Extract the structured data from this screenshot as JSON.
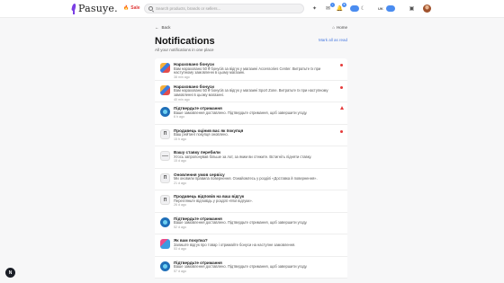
{
  "header": {
    "brand": "Pasuye.",
    "sale_label": "Sale",
    "search_placeholder": "Search products, brands or sellers...",
    "notifications_count": "5",
    "pill_1": "",
    "language": "UK",
    "pill_2": "",
    "icons": [
      "sparkles-icon",
      "bell-icon",
      "moon-icon",
      "orders-icon",
      "avatar"
    ]
  },
  "page": {
    "back_label": "Back",
    "home_label": "Home",
    "title": "Notifications",
    "subtitle": "All your notifications in one place",
    "mark_all_label": "Mark all as read"
  },
  "notifications": [
    {
      "icon": "gift",
      "title": "Нараховано бонуси",
      "text": "Вам нараховано 50 ₴ бонусів за відгук у магазині Accessories Center. Витратьте їх при наступному замовленні в цьому магазині.",
      "time": "38 min ago",
      "indicator": "dot"
    },
    {
      "icon": "gift",
      "title": "Нараховано бонуси",
      "text": "Вам нараховано 50 ₴ бонусів за відгук у магазині Sport Zone. Витратьте їх при наступному замовленні в цьому магазині.",
      "time": "40 min ago",
      "indicator": "dot"
    },
    {
      "icon": "ok",
      "title": "Підтвердьте отримання",
      "text": "Ваше замовлення доставлено. Підтвердьте отримання, щоб завершити угоду.",
      "time": "6 h ago",
      "indicator": "tri"
    },
    {
      "icon": "p",
      "title": "Продавець оцінив вас як покупця",
      "text": "Ваш рейтинг покупця оновлено.",
      "time": "15 h ago",
      "indicator": "dot"
    },
    {
      "icon": "line",
      "title": "Вашу ставку перебили",
      "text": "Хтось запропонував більше за лот, за яким ви стежите. Встигніть підняти ставку.",
      "time": "15 d ago",
      "indicator": ""
    },
    {
      "icon": "p",
      "title": "Оновлення умов сервісу",
      "text": "Ми оновили правила повернення. Ознайомтесь у розділі «Доставка й повернення».",
      "time": "21 d ago",
      "indicator": ""
    },
    {
      "icon": "p",
      "title": "Продавець відповів на ваш відгук",
      "text": "Перегляньте відповідь у розділі «Мої відгуки».",
      "time": "26 d ago",
      "indicator": ""
    },
    {
      "icon": "ok",
      "title": "Підтвердьте отримання",
      "text": "Ваше замовлення доставлено. Підтвердьте отримання, щоб завершити угоду.",
      "time": "52 d ago",
      "indicator": ""
    },
    {
      "icon": "q",
      "title": "Як вам покупка?",
      "text": "Залиште відгук про товар і отримайте бонуси на наступне замовлення.",
      "time": "53 d ago",
      "indicator": ""
    },
    {
      "icon": "ok",
      "title": "Підтвердьте отримання",
      "text": "Ваше замовлення доставлено. Підтвердьте отримання, щоб завершити угоду.",
      "time": "57 d ago",
      "indicator": ""
    }
  ],
  "fab_label": "N"
}
